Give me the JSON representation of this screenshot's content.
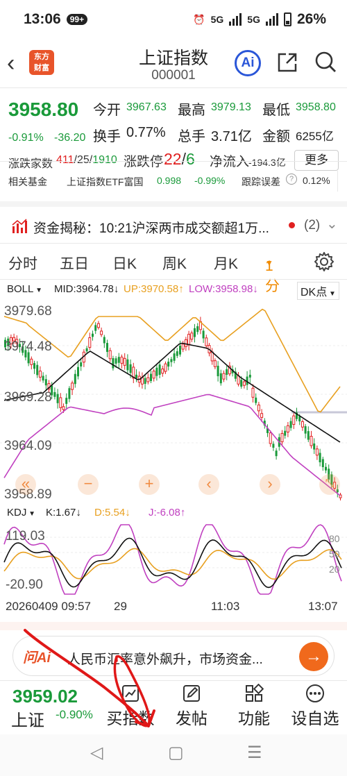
{
  "status": {
    "time": "13:06",
    "badge": "99+",
    "net1": "5G",
    "net2": "5G",
    "battery": "26%"
  },
  "header": {
    "title": "上证指数",
    "code": "000001",
    "logo_line1": "东方",
    "logo_line2": "财富",
    "ai_label": "Ai"
  },
  "quote": {
    "price": "3958.80",
    "pct": "-0.91%",
    "chg": "-36.20",
    "open_label": "今开",
    "open": "3967.63",
    "high_label": "最高",
    "high": "3979.13",
    "low_label": "最低",
    "low": "3958.80",
    "turnover_label": "换手",
    "turnover": "0.77%",
    "volume_label": "总手",
    "volume": "3.71亿",
    "amount_label": "金额",
    "amount": "6255亿",
    "updown_label": "涨跌家数",
    "up": "411",
    "flat": "25",
    "down": "1910",
    "limit_label": "涨跌停",
    "limit_up": "22",
    "limit_down": "6",
    "inflow_label": "净流入",
    "inflow": "-194.3亿",
    "more": "更多"
  },
  "fund": {
    "label": "相关基金",
    "name": "上证指数ETF富国",
    "price": "0.998",
    "pct": "-0.99%",
    "err_label": "跟踪误差",
    "err": "0.12%"
  },
  "news": {
    "text": "资金揭秘：10:21沪深两市成交额超1万...",
    "count": "(2)"
  },
  "tabs": [
    "分时",
    "五日",
    "日K",
    "周K",
    "月K",
    "1分"
  ],
  "boll": {
    "name": "BOLL",
    "mid": "MID:3964.78↓",
    "up": "UP:3970.58↑",
    "low": "LOW:3958.98↓",
    "dk": "DK点"
  },
  "price_axis": [
    "3979.68",
    "3974.48",
    "3969.28",
    "3964.09",
    "3958.89"
  ],
  "kdj": {
    "name": "KDJ",
    "k": "K:1.67↓",
    "d": "D:5.54↓",
    "j": "J:-6.08↑"
  },
  "kdj_axis": {
    "top": "119.03",
    "bottom": "-20.90",
    "r80": "80",
    "r50": "50",
    "r20": "20"
  },
  "time_axis": {
    "start": "20260409 09:57",
    "start_tail": "29",
    "mid": "11:03",
    "end": "13:07"
  },
  "ask": {
    "logo": "问Ai",
    "text": "人民币汇率意外飙升，市场资金..."
  },
  "bottom": {
    "price": "3959.02",
    "name": "上证",
    "pct": "-0.90%",
    "items": [
      "买指数",
      "发帖",
      "功能",
      "设自选"
    ]
  },
  "colors": {
    "rise": "#e02020",
    "fall": "#1a9a3a",
    "accent": "#f08a00",
    "boll_up": "#e8a020",
    "boll_low": "#c040c0"
  }
}
